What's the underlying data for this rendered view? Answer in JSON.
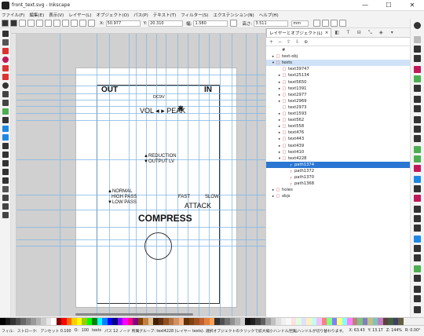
{
  "window": {
    "title": "front_text.svg - Inkscape",
    "minimize": "—",
    "maximize": "☐",
    "close": "✕"
  },
  "menu": [
    "ファイル(F)",
    "編集(E)",
    "表示(V)",
    "レイヤー(L)",
    "オブジェクト(O)",
    "パス(P)",
    "テキスト(T)",
    "フィルター(S)",
    "エクステンション(N)",
    "ヘルプ(H)"
  ],
  "toolcontrols": {
    "x_label": "X:",
    "x": "50.977",
    "y_label": "Y:",
    "y": "20.310",
    "w_label": "幅:",
    "w": "1.580",
    "h_label": "高さ:",
    "h": "3.511",
    "units": "mm"
  },
  "panel": {
    "tab_label": "レイヤーとオブジェクト(L)",
    "tab_close": "×",
    "tools": [
      "+",
      "−",
      "⇧",
      "⇩",
      "⊕"
    ],
    "rows": [
      {
        "label": "#",
        "depth": 0,
        "arrow": "",
        "icon": "",
        "sel": false,
        "hl": false
      },
      {
        "label": "text-obj",
        "depth": 0,
        "arrow": "▸",
        "icon": "□",
        "sel": false,
        "hl": false
      },
      {
        "label": "texts",
        "depth": 0,
        "arrow": "▾",
        "icon": "□",
        "sel": false,
        "hl": true
      },
      {
        "label": "text39747",
        "depth": 1,
        "arrow": "",
        "icon": "□",
        "sel": false,
        "hl": false
      },
      {
        "label": "text25134",
        "depth": 1,
        "arrow": "▸",
        "icon": "□",
        "sel": false,
        "hl": false
      },
      {
        "label": "text5650",
        "depth": 1,
        "arrow": "▸",
        "icon": "□",
        "sel": false,
        "hl": false
      },
      {
        "label": "text1391",
        "depth": 1,
        "arrow": "▸",
        "icon": "□",
        "sel": false,
        "hl": false
      },
      {
        "label": "text2977",
        "depth": 1,
        "arrow": "▸",
        "icon": "□",
        "sel": false,
        "hl": false
      },
      {
        "label": "text2969",
        "depth": 1,
        "arrow": "▸",
        "icon": "□",
        "sel": false,
        "hl": false
      },
      {
        "label": "text2973",
        "depth": 1,
        "arrow": "",
        "icon": "□",
        "sel": false,
        "hl": false
      },
      {
        "label": "text1593",
        "depth": 1,
        "arrow": "▸",
        "icon": "□",
        "sel": false,
        "hl": false
      },
      {
        "label": "text562",
        "depth": 1,
        "arrow": "▸",
        "icon": "□",
        "sel": false,
        "hl": false
      },
      {
        "label": "text558",
        "depth": 1,
        "arrow": "▸",
        "icon": "□",
        "sel": false,
        "hl": false
      },
      {
        "label": "text476",
        "depth": 1,
        "arrow": "▸",
        "icon": "□",
        "sel": false,
        "hl": false
      },
      {
        "label": "text443",
        "depth": 1,
        "arrow": "▸",
        "icon": "□",
        "sel": false,
        "hl": false
      },
      {
        "label": "text439",
        "depth": 1,
        "arrow": "▸",
        "icon": "□",
        "sel": false,
        "hl": false
      },
      {
        "label": "text410",
        "depth": 1,
        "arrow": "▸",
        "icon": "□",
        "sel": false,
        "hl": false
      },
      {
        "label": "text4228",
        "depth": 1,
        "arrow": "▾",
        "icon": "□",
        "sel": false,
        "hl": false
      },
      {
        "label": "path1374",
        "depth": 2,
        "arrow": "",
        "icon": "┌",
        "sel": true,
        "hl": false
      },
      {
        "label": "path1372",
        "depth": 2,
        "arrow": "",
        "icon": "┌",
        "sel": false,
        "hl": false
      },
      {
        "label": "path1370",
        "depth": 2,
        "arrow": "",
        "icon": "┌",
        "sel": false,
        "hl": false
      },
      {
        "label": "path1368",
        "depth": 2,
        "arrow": "",
        "icon": "┌",
        "sel": false,
        "hl": false
      },
      {
        "label": "holes",
        "depth": 0,
        "arrow": "▸",
        "icon": "□",
        "sel": false,
        "hl": false
      },
      {
        "label": "objs",
        "depth": 0,
        "arrow": "▸",
        "icon": "□",
        "sel": false,
        "hl": false
      }
    ]
  },
  "canvas_text": {
    "out": "OUT",
    "in": "IN",
    "dc9v": "DC9V",
    "vol": "VOL ◂ ▸ PEAK",
    "reduction": "▲REDUCTION",
    "output": "▼OUTPUT LV",
    "normal": "▲NORMAL",
    "highpass": "HIGH PASS",
    "lowpass": "▼LOW PASS",
    "fast": "FAST",
    "slow": "SLOW",
    "attack": "ATTACK",
    "compress": "COMPRESS"
  },
  "palette_colors": [
    "#000000",
    "#1a1a1a",
    "#333333",
    "#4d4d4d",
    "#666666",
    "#808080",
    "#999999",
    "#b3b3b3",
    "#cccccc",
    "#e6e6e6",
    "#ffffff",
    "#800000",
    "#ff0000",
    "#ff6600",
    "#ffcc00",
    "#ffff00",
    "#99cc00",
    "#00ff00",
    "#008000",
    "#00ffff",
    "#0080ff",
    "#0000ff",
    "#000080",
    "#8000ff",
    "#ff00ff",
    "#ff0080",
    "#800080",
    "#804000",
    "#c08040",
    "#e0c090",
    "#402000",
    "#603010",
    "#905020",
    "#b07040",
    "#d09060",
    "#f0b080",
    "#603000",
    "#804010",
    "#a05020",
    "#c06030",
    "#e08040",
    "#ffa050",
    "#303030",
    "#505050",
    "#707070",
    "#909090",
    "#b0b0b0",
    "#d0d0d0",
    "#101010",
    "#202020",
    "#404040",
    "#606060",
    "#a0a0a0",
    "#c0c0c0",
    "#e0e0e0",
    "#f0f0f0",
    "#f8f8f8",
    "#ffe0e0",
    "#e0ffe0",
    "#e0e0ff",
    "#fff0c0",
    "#c0fff0",
    "#f0c0ff",
    "#ff8080",
    "#80ff80",
    "#8080ff",
    "#ffff80",
    "#80ffff",
    "#ff80ff",
    "#c08080",
    "#80c080",
    "#8080c0",
    "#c0c080",
    "#80c0c0",
    "#c080c0",
    "#604040",
    "#406040",
    "#404060",
    "#606040"
  ],
  "status": {
    "fill_label": "フィル:",
    "stroke_label": "ストローク:",
    "stroke_value": "アンセット 0.100",
    "opacity_label": "O:",
    "opacity": "100",
    "layer": "texts",
    "message": "パス 12 ノード 所属グループ: text4228 (レイヤー texts). 選択オブジェクトのクリックで拡大縮小ハンドル/回転ハンドルが切り替わります。",
    "x": "X: 63.43",
    "y": "Y: 13.17",
    "zoom": "Z: 144%",
    "rot": "R: 0.00°"
  }
}
